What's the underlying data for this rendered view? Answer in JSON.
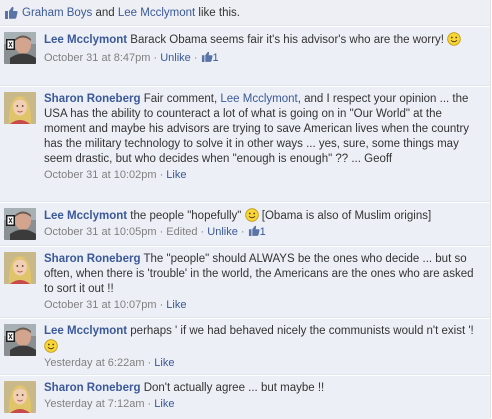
{
  "likes_bar": {
    "user1": "Graham Boys",
    "connector": " and ",
    "user2": "Lee Mcclymont",
    "suffix": " like this."
  },
  "actions": {
    "unlike": "Unlike",
    "like": "Like",
    "separator": " · "
  },
  "comments": [
    {
      "author": "Lee Mcclymont",
      "avatar": "avatar-lee-icon",
      "text": "Barack Obama seems fair it's his advisor's who are the worry!",
      "timestamp": "October 31 at 8:47pm",
      "action": "Unlike",
      "like_count": "1"
    },
    {
      "author": "Sharon Roneberg",
      "avatar": "avatar-sharon-icon",
      "text_before_mention": "Fair comment, ",
      "mention": "Lee Mcclymont",
      "text_after_mention": ", and I respect your opinion ... the USA has the ability to counteract a lot of what is going on in \"Our World\" at the moment and maybe his advisors are trying to save American lives when the country has the military technology to solve it in other ways ... yes, sure, some things may seem drastic, but who decides when \"enough is enough\" ?? ... Geoff",
      "timestamp": "October 31 at 10:02pm",
      "action": "Like"
    },
    {
      "author": "Lee Mcclymont",
      "avatar": "avatar-lee-icon",
      "text_before": "the people \"hopefully\"",
      "text_after": "[Obama is also of Muslim origins]",
      "timestamp": "October 31 at 10:05pm",
      "edited": "Edited",
      "action": "Unlike",
      "like_count": "1"
    },
    {
      "author": "Sharon Roneberg",
      "avatar": "avatar-sharon-icon",
      "text": "The \"people\" should ALWAYS be the ones who decide ... but so often, when there is 'trouble' in the world, the Americans are the ones who are asked to sort it out !!",
      "timestamp": "October 31 at 10:07pm",
      "action": "Like"
    },
    {
      "author": "Lee Mcclymont",
      "avatar": "avatar-lee-icon",
      "text": "perhaps ' if we had behaved nicely the communists would n't exist '!",
      "timestamp": "Yesterday at 6:22am",
      "action": "Like"
    },
    {
      "author": "Sharon Roneberg",
      "avatar": "avatar-sharon-icon",
      "text": "Don't actually agree ... but maybe !!",
      "timestamp": "Yesterday at 7:12am",
      "action": "Like"
    }
  ],
  "colors": {
    "link": "#3b5998",
    "comment_bg": "#eceff5",
    "meta": "#808080"
  }
}
